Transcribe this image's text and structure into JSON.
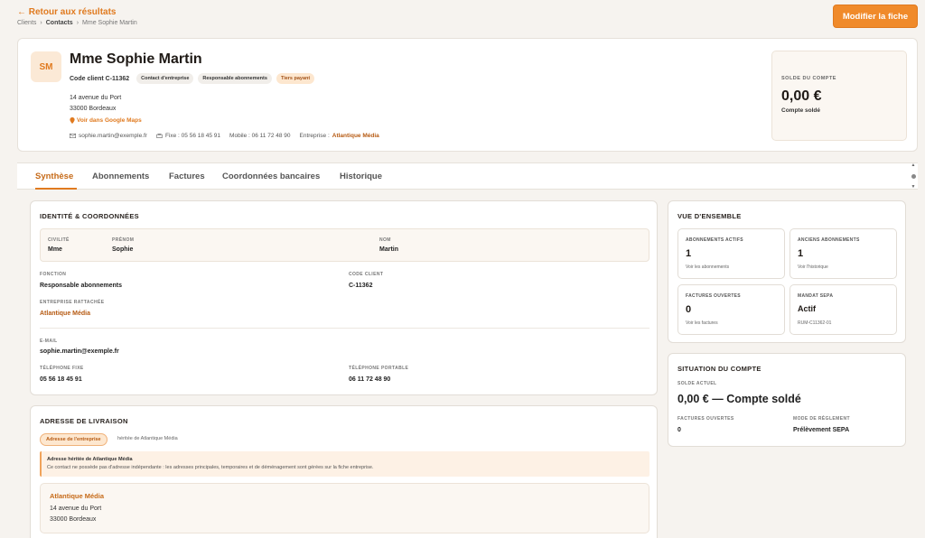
{
  "header": {
    "back_label": "← Retour aux résultats",
    "breadcrumb": [
      "Clients",
      "Contacts",
      "Mme Sophie Martin"
    ],
    "breadcrumb_sep": "›",
    "edit_button": "Modifier la fiche"
  },
  "profile": {
    "initials": "SM",
    "name": "Mme Sophie Martin",
    "code_client": "Code client C-11362",
    "badges": [
      "Contact d'entreprise",
      "Responsable abonnements",
      "Tiers payant"
    ],
    "address_line1": "14 avenue du Port",
    "address_line2": "33000 Bordeaux",
    "maps_link": "Voir dans Google Maps",
    "email": "sophie.martin@exemple.fr",
    "phone_fixe": "Fixe : 05 56 18 45 91",
    "phone_mobile": "Mobile : 06 11 72 48 90",
    "company_prefix": "Entreprise :",
    "company": "Atlantique Média"
  },
  "balance": {
    "label": "SOLDE DU COMPTE",
    "amount": "0,00 €",
    "status": "Compte soldé"
  },
  "tabs": [
    "Synthèse",
    "Abonnements",
    "Factures",
    "Coordonnées bancaires",
    "Historique"
  ],
  "identity": {
    "title": "IDENTITÉ & COORDONNÉES",
    "civilite_label": "CIVILITÉ",
    "civilite": "Mme",
    "prenom_label": "PRÉNOM",
    "prenom": "Sophie",
    "nom_label": "NOM",
    "nom": "Martin",
    "fonction_label": "FONCTION",
    "fonction": "Responsable abonnements",
    "code_label": "CODE CLIENT",
    "code": "C-11362",
    "entreprise_label": "ENTREPRISE RATTACHÉE",
    "entreprise": "Atlantique Média",
    "email_label": "E-MAIL",
    "email": "sophie.martin@exemple.fr",
    "fixe_label": "TÉLÉPHONE FIXE",
    "fixe": "05 56 18 45 91",
    "portable_label": "TÉLÉPHONE PORTABLE",
    "portable": "06 11 72 48 90"
  },
  "delivery": {
    "title": "ADRESSE DE LIVRAISON",
    "chip": "Adresse de l'entreprise",
    "chip_sub": "héritée de Atlantique Média",
    "notice_title": "Adresse héritée de Atlantique Média",
    "notice_text": "Ce contact ne possède pas d'adresse indépendante : les adresses principales, temporaires et de déménagement sont gérées sur la fiche entreprise.",
    "company": "Atlantique Média",
    "line1": "14 avenue du Port",
    "line2": "33000 Bordeaux"
  },
  "overview": {
    "title": "VUE D'ENSEMBLE",
    "stats": [
      {
        "label": "ABONNEMENTS ACTIFS",
        "value": "1",
        "link": "Voir les abonnements"
      },
      {
        "label": "ANCIENS ABONNEMENTS",
        "value": "1",
        "link": "Voir l'historique"
      },
      {
        "label": "FACTURES OUVERTES",
        "value": "0",
        "link": "Voir les factures"
      },
      {
        "label": "MANDAT SEPA",
        "value": "Actif",
        "link": "RUM-C11362-01"
      }
    ]
  },
  "account": {
    "title": "SITUATION DU COMPTE",
    "solde_label": "SOLDE ACTUEL",
    "solde": "0,00 € — Compte soldé",
    "factures_label": "FACTURES OUVERTES",
    "factures": "0",
    "mode_label": "MODE DE RÈGLEMENT",
    "mode": "Prélèvement SEPA"
  },
  "colors": {
    "accent": "#e07a1f",
    "button": "#f08a2a",
    "background": "#f6f3ef"
  },
  "icons": [
    "email-icon",
    "phone-icon",
    "map-pin-icon"
  ]
}
